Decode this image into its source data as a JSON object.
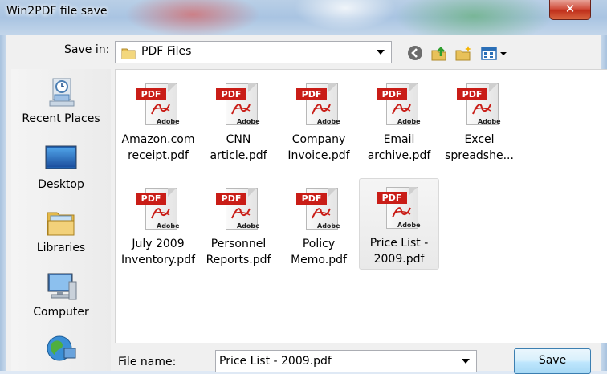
{
  "window": {
    "title": "Win2PDF file save",
    "close_glyph": "✕"
  },
  "save_in": {
    "label": "Save in:",
    "value": "PDF Files"
  },
  "toolbar": {
    "icons": [
      "back-icon",
      "up-folder-icon",
      "new-folder-icon",
      "view-menu-icon"
    ]
  },
  "places": [
    {
      "label": "Recent Places",
      "icon": "recent-places-icon"
    },
    {
      "label": "Desktop",
      "icon": "desktop-icon"
    },
    {
      "label": "Libraries",
      "icon": "libraries-icon"
    },
    {
      "label": "Computer",
      "icon": "computer-icon"
    },
    {
      "label": "",
      "icon": "network-icon"
    }
  ],
  "pdf_icon": {
    "banner": "PDF",
    "brand": "Adobe"
  },
  "files": [
    {
      "line1": "Amazon.com",
      "line2": "receipt.pdf",
      "selected": false
    },
    {
      "line1": "CNN",
      "line2": "article.pdf",
      "selected": false
    },
    {
      "line1": "Company",
      "line2": "Invoice.pdf",
      "selected": false
    },
    {
      "line1": "Email",
      "line2": "archive.pdf",
      "selected": false
    },
    {
      "line1": "Excel",
      "line2": "spreadshe...",
      "selected": false
    },
    {
      "line1": "July 2009",
      "line2": "Inventory.pdf",
      "selected": false
    },
    {
      "line1": "Personnel",
      "line2": "Reports.pdf",
      "selected": false
    },
    {
      "line1": "Policy",
      "line2": "Memo.pdf",
      "selected": false
    },
    {
      "line1": "Price List -",
      "line2": "2009.pdf",
      "selected": true
    }
  ],
  "file_name": {
    "label": "File name:",
    "value": "Price List - 2009.pdf"
  },
  "buttons": {
    "save": "Save"
  },
  "colors": {
    "pdf_red": "#c91d17",
    "selection": "#e9e9e9",
    "button_border": "#3c7fb1"
  }
}
